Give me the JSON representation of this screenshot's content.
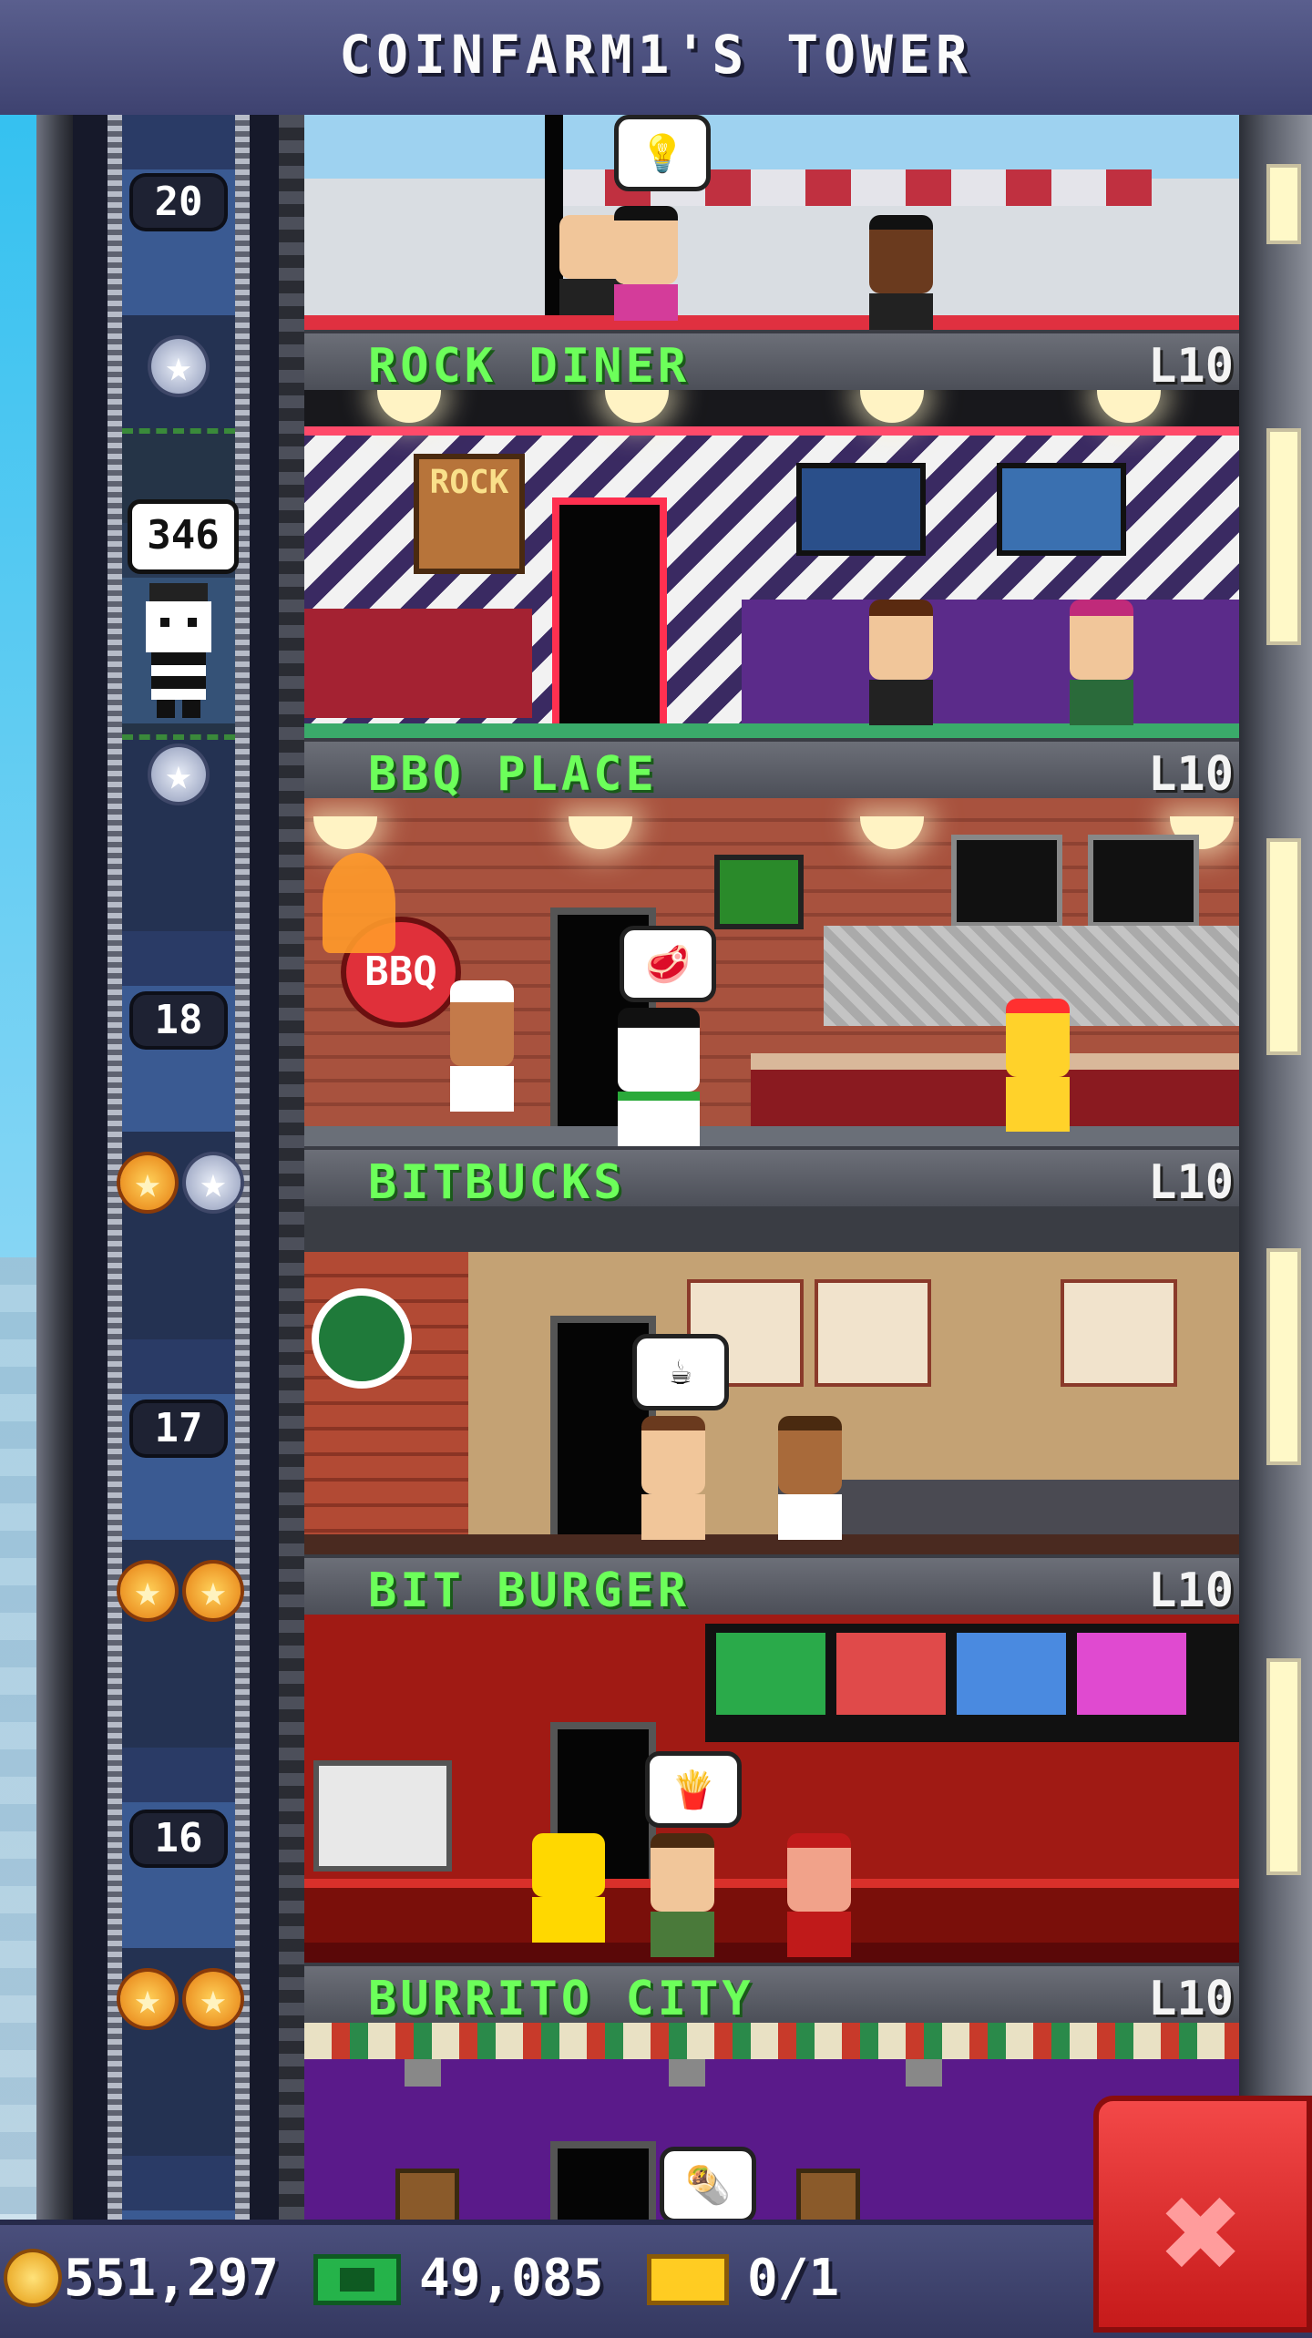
{
  "header": {
    "title": "COINFARM1'S TOWER"
  },
  "elevator": {
    "passenger_count": "346"
  },
  "shaft_floor_numbers": [
    "20",
    "18",
    "17",
    "16"
  ],
  "floors": [
    {
      "name": "ROCK DINER",
      "level": "L10"
    },
    {
      "name": "BBQ PLACE",
      "level": "L10"
    },
    {
      "name": "BITBUCKS",
      "level": "L10"
    },
    {
      "name": "BIT BURGER",
      "level": "L10"
    },
    {
      "name": "BURRITO CITY",
      "level": "L10"
    }
  ],
  "signs": {
    "bbq": "BBQ",
    "rock": "ROCK"
  },
  "bottom_bar": {
    "coins": "551,297",
    "bux": "49,085",
    "tickets": "0/1"
  },
  "icons": [
    "coin-icon",
    "bux-icon",
    "ticket-icon",
    "close-icon",
    "star-icon"
  ],
  "colors": {
    "floor_name": "#6cff5a",
    "header": "#4a4f7c",
    "close_button": "#e03030"
  }
}
